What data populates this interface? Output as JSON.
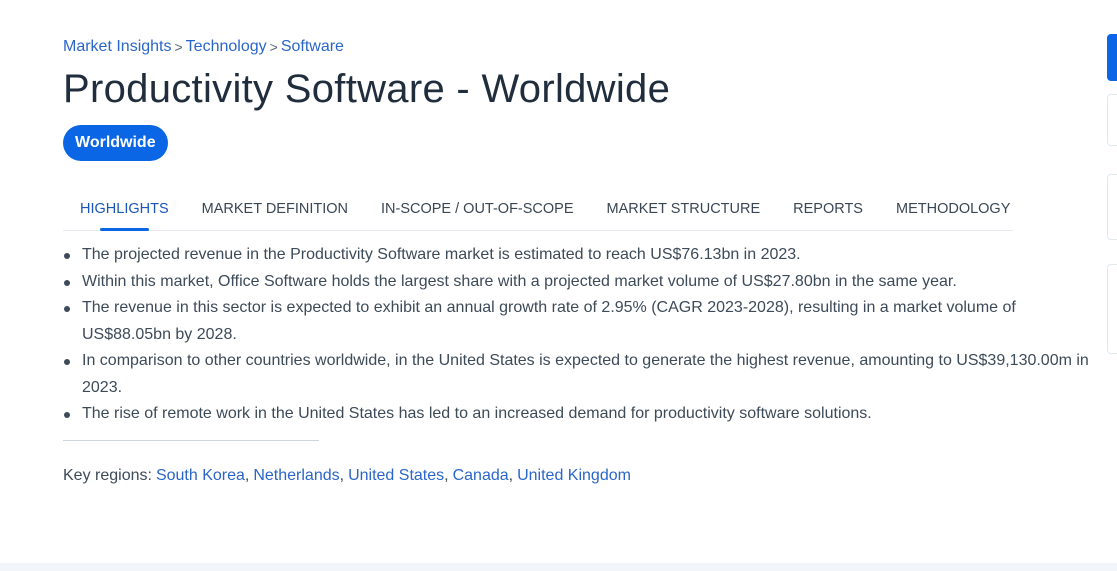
{
  "breadcrumb": [
    {
      "label": "Market Insights"
    },
    {
      "label": "Technology"
    },
    {
      "label": "Software"
    }
  ],
  "breadcrumb_separator": ">",
  "page_title": "Productivity Software - Worldwide",
  "region_pill": "Worldwide",
  "tabs": [
    {
      "label": "HIGHLIGHTS",
      "active": true
    },
    {
      "label": "MARKET DEFINITION",
      "active": false
    },
    {
      "label": "IN-SCOPE / OUT-OF-SCOPE",
      "active": false
    },
    {
      "label": "MARKET STRUCTURE",
      "active": false
    },
    {
      "label": "REPORTS",
      "active": false
    },
    {
      "label": "METHODOLOGY",
      "active": false
    }
  ],
  "highlights": [
    "The projected revenue in the Productivity Software market is estimated to reach US$76.13bn in 2023.",
    "Within this market, Office Software holds the largest share with a projected market volume of US$27.80bn in the same year.",
    "The revenue in this sector is expected to exhibit an annual growth rate of 2.95% (CAGR 2023-2028), resulting in a market volume of US$88.05bn by 2028.",
    "In comparison to other countries worldwide, in the United States is expected to generate the highest revenue, amounting to US$39,130.00m in 2023.",
    "The rise of remote work in the United States has led to an increased demand for productivity software solutions."
  ],
  "key_regions": {
    "label": "Key regions:",
    "separator": ",",
    "regions": [
      "South Korea",
      "Netherlands",
      "United States",
      "Canada",
      "United Kingdom"
    ]
  },
  "colors": {
    "accent": "#0a66e4",
    "link": "#2a66c9",
    "text": "#3d4a58",
    "title": "#1f2d3d"
  }
}
